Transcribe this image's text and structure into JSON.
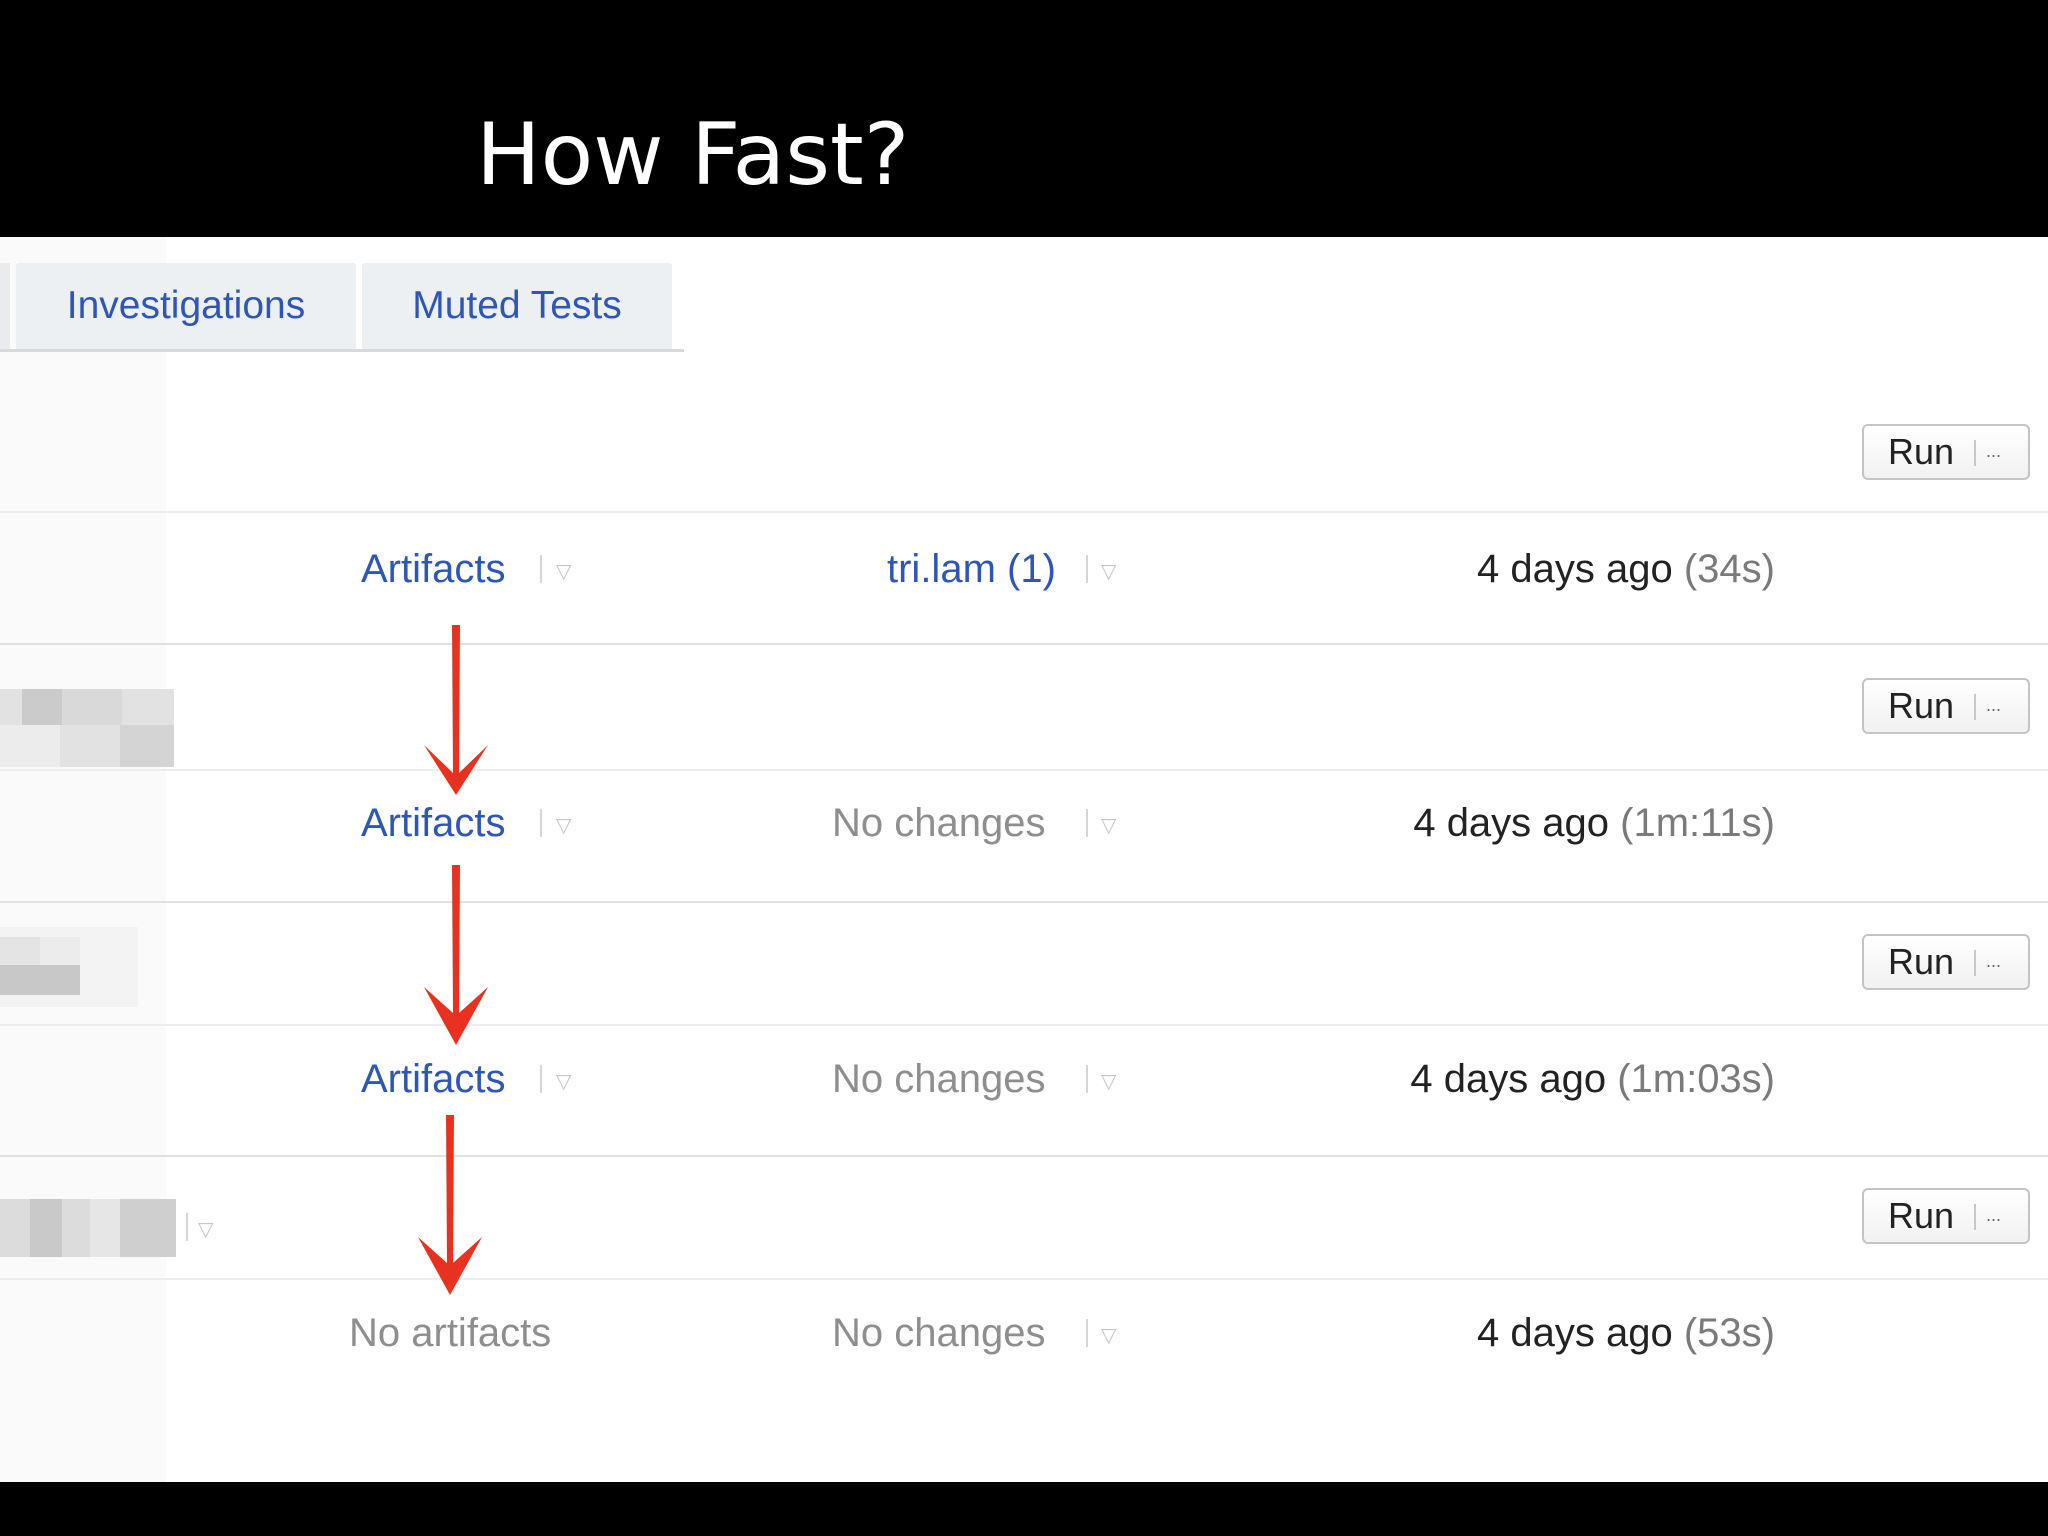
{
  "slide": {
    "title": "How Fast?"
  },
  "tabs": [
    {
      "label": "Investigations"
    },
    {
      "label": "Muted Tests"
    }
  ],
  "run_button": {
    "label": "Run",
    "more": "..."
  },
  "builds": [
    {
      "artifacts": "Artifacts",
      "changes": "tri.lam (1)",
      "time": "4 days ago",
      "duration": "(34s)"
    },
    {
      "artifacts": "Artifacts",
      "changes": "No changes",
      "time": "4 days ago",
      "duration": "(1m:11s)"
    },
    {
      "artifacts": "Artifacts",
      "changes": "No changes",
      "time": "4 days ago",
      "duration": "(1m:03s)"
    },
    {
      "artifacts": "No artifacts",
      "changes": "No changes",
      "time": "4 days ago",
      "duration": "(53s)"
    }
  ],
  "icons": [
    "dropdown-caret-icon",
    "down-arrow-annotation"
  ],
  "colors": {
    "link": "#2d56b7",
    "arrow": "#e8321f",
    "background": "#000000"
  }
}
